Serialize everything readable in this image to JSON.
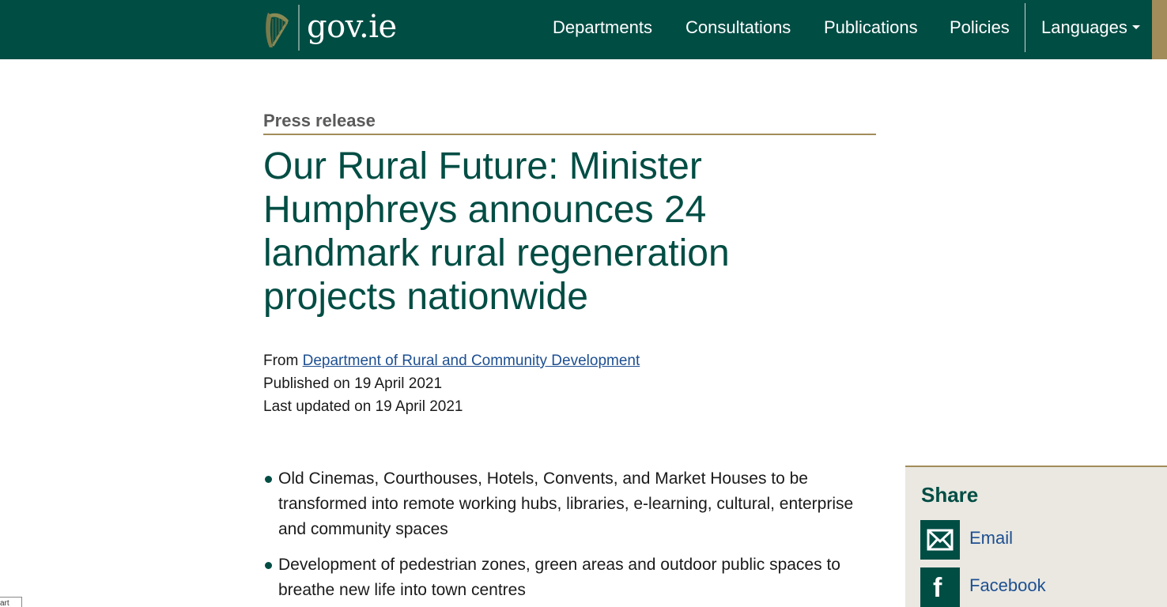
{
  "header": {
    "logo_text": "gov.ie",
    "logo_icon": "harp-icon",
    "nav": [
      {
        "label": "Departments"
      },
      {
        "label": "Consultations"
      },
      {
        "label": "Publications"
      },
      {
        "label": "Policies"
      }
    ],
    "languages_label": "Languages"
  },
  "article": {
    "type_label": "Press release",
    "title": "Our Rural Future: Minister Humphreys announces 24 landmark rural regeneration projects nationwide",
    "from_prefix": "From ",
    "from_link": "Department of Rural and Community Development",
    "published": "Published on 19 April 2021",
    "updated": "Last updated on 19 April 2021",
    "bullets": [
      "Old Cinemas, Courthouses, Hotels, Convents, and Market Houses to be transformed into remote working hubs, libraries, e-learning, cultural, enterprise and community spaces",
      "Development of pedestrian zones, green areas and outdoor public spaces to breathe new life into town centres"
    ]
  },
  "share": {
    "title": "Share",
    "items": [
      {
        "label": "Email",
        "icon": "envelope-icon"
      },
      {
        "label": "Facebook",
        "icon": "facebook-icon"
      }
    ]
  },
  "corner_fragment": "art",
  "colors": {
    "header_bg": "#004d44",
    "accent_gold": "#a28c5a",
    "title": "#004d44",
    "link": "#1d4f91",
    "share_bg": "#eae8e1"
  }
}
